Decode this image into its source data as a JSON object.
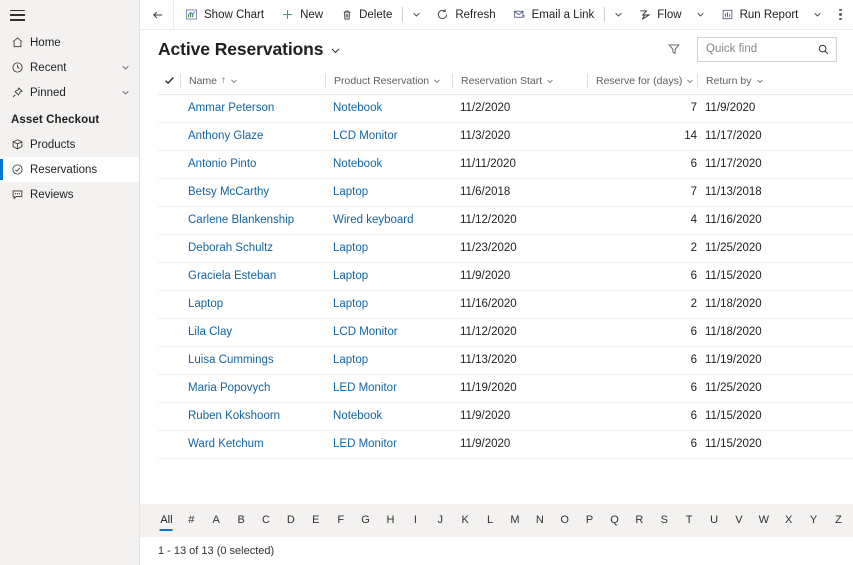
{
  "sidebar": {
    "hamburger_label": "Site Map",
    "items": [
      {
        "label": "Home",
        "icon": "home-icon",
        "chevron": false,
        "selected": false
      },
      {
        "label": "Recent",
        "icon": "clock-icon",
        "chevron": true,
        "selected": false
      },
      {
        "label": "Pinned",
        "icon": "pin-icon",
        "chevron": true,
        "selected": false
      }
    ],
    "group_title": "Asset Checkout",
    "group_items": [
      {
        "label": "Products",
        "icon": "box-icon",
        "selected": false
      },
      {
        "label": "Reservations",
        "icon": "check-circle-icon",
        "selected": true
      },
      {
        "label": "Reviews",
        "icon": "comment-icon",
        "selected": false
      }
    ],
    "accent_color": "#0078d4",
    "background_color": "#f3f2f1"
  },
  "commandbar": {
    "back_label": "Back",
    "buttons": [
      {
        "label": "Show Chart",
        "icon": "chart-icon",
        "chevron": false
      },
      {
        "label": "New",
        "icon": "plus-icon",
        "chevron": false
      },
      {
        "label": "Delete",
        "icon": "trash-icon",
        "chevron": true
      },
      {
        "label": "Refresh",
        "icon": "refresh-icon",
        "chevron": false
      },
      {
        "label": "Email a Link",
        "icon": "email-icon",
        "chevron": true
      },
      {
        "label": "Flow",
        "icon": "flow-icon",
        "chevron": true
      },
      {
        "label": "Run Report",
        "icon": "report-icon",
        "chevron": true
      }
    ],
    "more_label": "More commands"
  },
  "header": {
    "title": "Active Reservations",
    "title_chevron": "chevron-down-icon",
    "filter_label": "Filter",
    "search": {
      "placeholder": "Quick find",
      "value": "",
      "icon": "search-icon"
    }
  },
  "grid": {
    "select_all_icon": "checkmark-icon",
    "columns": [
      {
        "label": "Name",
        "sorted": true,
        "sort_dir": "↑",
        "align": "left"
      },
      {
        "label": "Product Reservation",
        "sorted": false,
        "sort_dir": "",
        "align": "left"
      },
      {
        "label": "Reservation Start",
        "sorted": false,
        "sort_dir": "",
        "align": "left"
      },
      {
        "label": "Reserve for (days)",
        "sorted": false,
        "sort_dir": "",
        "align": "right"
      },
      {
        "label": "Return by",
        "sorted": false,
        "sort_dir": "",
        "align": "left"
      }
    ],
    "rows": [
      {
        "name": "Ammar Peterson",
        "product": "Notebook",
        "start": "11/2/2020",
        "days": "7",
        "return": "11/9/2020"
      },
      {
        "name": "Anthony Glaze",
        "product": "LCD Monitor",
        "start": "11/3/2020",
        "days": "14",
        "return": "11/17/2020"
      },
      {
        "name": "Antonio Pinto",
        "product": "Notebook",
        "start": "11/11/2020",
        "days": "6",
        "return": "11/17/2020"
      },
      {
        "name": "Betsy McCarthy",
        "product": "Laptop",
        "start": "11/6/2018",
        "days": "7",
        "return": "11/13/2018"
      },
      {
        "name": "Carlene Blankenship",
        "product": "Wired keyboard",
        "start": "11/12/2020",
        "days": "4",
        "return": "11/16/2020"
      },
      {
        "name": "Deborah Schultz",
        "product": "Laptop",
        "start": "11/23/2020",
        "days": "2",
        "return": "11/25/2020"
      },
      {
        "name": "Graciela Esteban",
        "product": "Laptop",
        "start": "11/9/2020",
        "days": "6",
        "return": "11/15/2020"
      },
      {
        "name": "Laptop",
        "product": "Laptop",
        "start": "11/16/2020",
        "days": "2",
        "return": "11/18/2020"
      },
      {
        "name": "Lila Clay",
        "product": "LCD Monitor",
        "start": "11/12/2020",
        "days": "6",
        "return": "11/18/2020"
      },
      {
        "name": "Luisa Cummings",
        "product": "Laptop",
        "start": "11/13/2020",
        "days": "6",
        "return": "11/19/2020"
      },
      {
        "name": "Maria Popovych",
        "product": "LED Monitor",
        "start": "11/19/2020",
        "days": "6",
        "return": "11/25/2020"
      },
      {
        "name": "Ruben Kokshoorn",
        "product": "Notebook",
        "start": "11/9/2020",
        "days": "6",
        "return": "11/15/2020"
      },
      {
        "name": "Ward Ketchum",
        "product": "LED Monitor",
        "start": "11/9/2020",
        "days": "6",
        "return": "11/15/2020"
      }
    ],
    "link_color": "#1264a3"
  },
  "alphabar": {
    "active": "All",
    "entries": [
      "All",
      "#",
      "A",
      "B",
      "C",
      "D",
      "E",
      "F",
      "G",
      "H",
      "I",
      "J",
      "K",
      "L",
      "M",
      "N",
      "O",
      "P",
      "Q",
      "R",
      "S",
      "T",
      "U",
      "V",
      "W",
      "X",
      "Y",
      "Z"
    ]
  },
  "statusbar": {
    "text": "1 - 13 of 13 (0 selected)"
  }
}
